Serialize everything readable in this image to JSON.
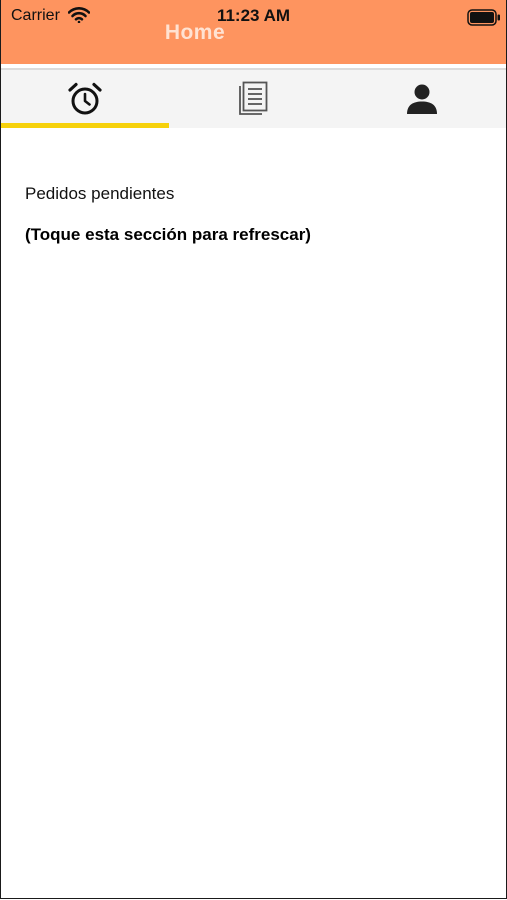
{
  "status_bar": {
    "carrier": "Carrier",
    "time": "11:23 AM",
    "icons": [
      "wifi-icon",
      "battery-icon"
    ]
  },
  "header": {
    "title": "Home",
    "background_color": "#fe945f"
  },
  "tabs": [
    {
      "icon": "alarm-clock-icon",
      "active": true
    },
    {
      "icon": "document-list-icon",
      "active": false
    },
    {
      "icon": "user-icon",
      "active": false
    }
  ],
  "tab_indicator_color": "#f6d10b",
  "main": {
    "section_title": "Pedidos pendientes",
    "refresh_hint": "(Toque esta sección para refrescar)"
  }
}
